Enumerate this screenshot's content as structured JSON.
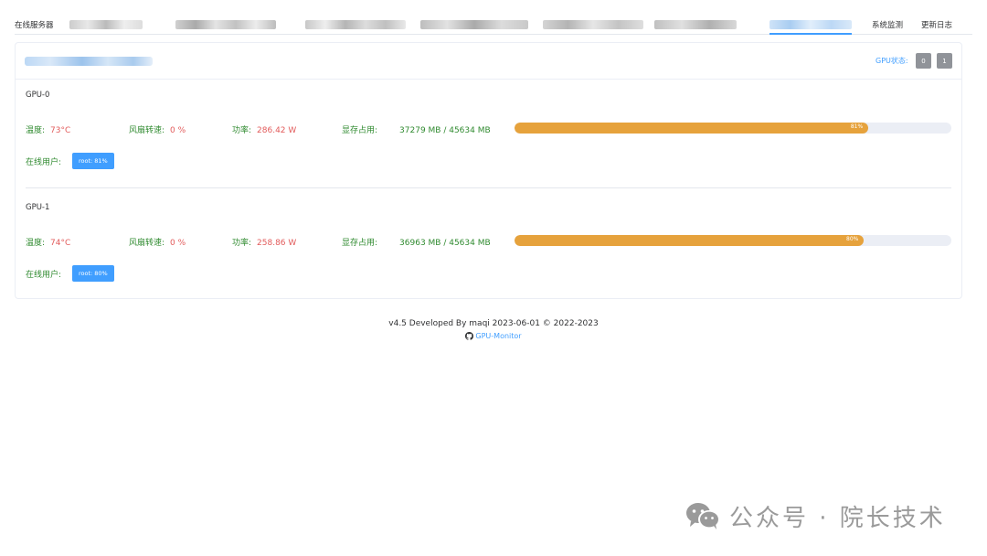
{
  "nav": {
    "online_servers_label": "在线服务器",
    "system_monitor": "系统监测",
    "changelog": "更新日志"
  },
  "card": {
    "gpu_status_label": "GPU状态:",
    "status_buttons": [
      "0",
      "1"
    ]
  },
  "labels": {
    "temp": "温度:",
    "fan": "风扇转速:",
    "power": "功率:",
    "mem": "显存占用:",
    "users": "在线用户:"
  },
  "gpus": [
    {
      "name": "GPU-0",
      "temp": "73°C",
      "fan": "0 %",
      "power": "286.42 W",
      "memory": "37279 MB / 45634 MB",
      "mem_percent": 81,
      "mem_percent_label": "81%",
      "user_tag": "root: 81%"
    },
    {
      "name": "GPU-1",
      "temp": "74°C",
      "fan": "0 %",
      "power": "258.86 W",
      "memory": "36963 MB / 45634 MB",
      "mem_percent": 80,
      "mem_percent_label": "80%",
      "user_tag": "root: 80%"
    }
  ],
  "footer": {
    "text": "v4.5 Developed By maqi 2023-06-01 © 2022-2023",
    "repo_link": "GPU-Monitor"
  },
  "watermark": {
    "text": "公众号 · 院长技术",
    "icon": "wechat-icon"
  },
  "colors": {
    "accent": "#409eff",
    "progress": "#e6a23c",
    "ok": "#2f8a2f",
    "warn": "#e25b5b"
  }
}
